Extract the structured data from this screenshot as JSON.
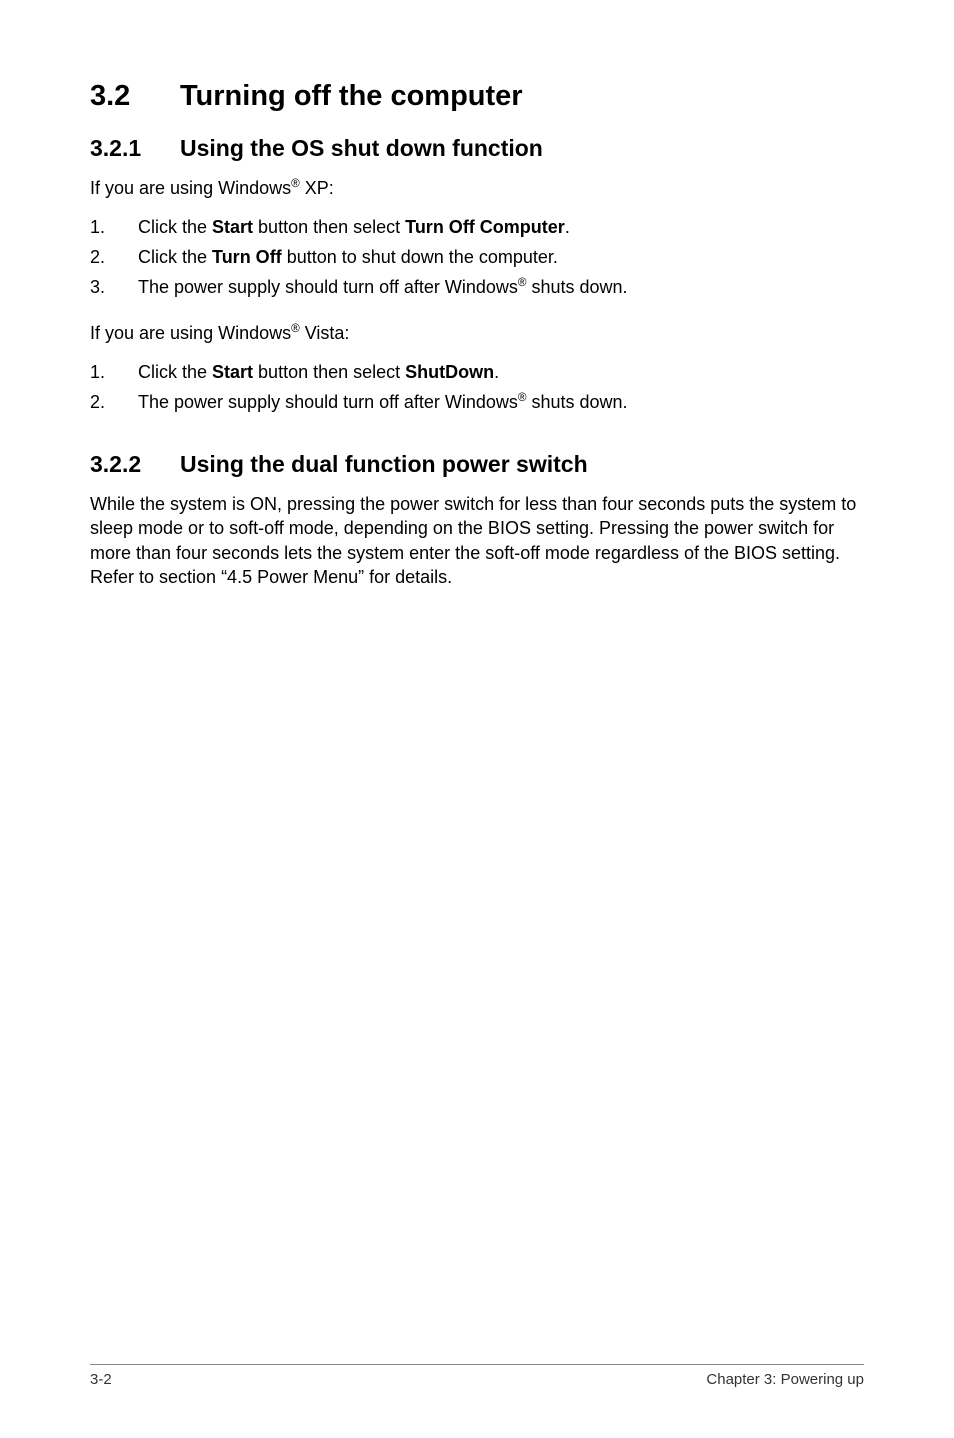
{
  "heading": {
    "number": "3.2",
    "title": "Turning off the computer"
  },
  "sections": [
    {
      "number": "3.2.1",
      "title": "Using the OS shut down function",
      "intro_xp_pre": "If you are using Windows",
      "intro_xp_post": " XP:",
      "steps_xp": [
        {
          "num": "1.",
          "html": "Click the <span class=\"b\">Start</span> button then select <span class=\"b\">Turn Off Computer</span>."
        },
        {
          "num": "2.",
          "html": "Click the <span class=\"b\">Turn Off</span> button to shut down the computer."
        },
        {
          "num": "3.",
          "html": "The power supply should turn off after Windows<sup>®</sup> shuts down."
        }
      ],
      "intro_vista_pre": "If you are using Windows",
      "intro_vista_post": " Vista:",
      "steps_vista": [
        {
          "num": "1.",
          "html": "Click the <span class=\"b\">Start</span> button then select <span class=\"b\">ShutDown</span>."
        },
        {
          "num": "2.",
          "html": "The power supply should turn off after Windows<sup>®</sup> shuts down."
        }
      ]
    },
    {
      "number": "3.2.2",
      "title": "Using the dual function power switch",
      "body": "While the system is ON, pressing the power switch for less than four seconds puts the system to sleep mode or to soft-off mode, depending on the BIOS setting. Pressing the power switch for more than four seconds lets the system enter the soft-off mode regardless of the BIOS setting. Refer to section  “4.5 Power Menu” for details."
    }
  ],
  "footer": {
    "left": "3-2",
    "right": "Chapter 3: Powering up"
  },
  "reg_mark": "®"
}
